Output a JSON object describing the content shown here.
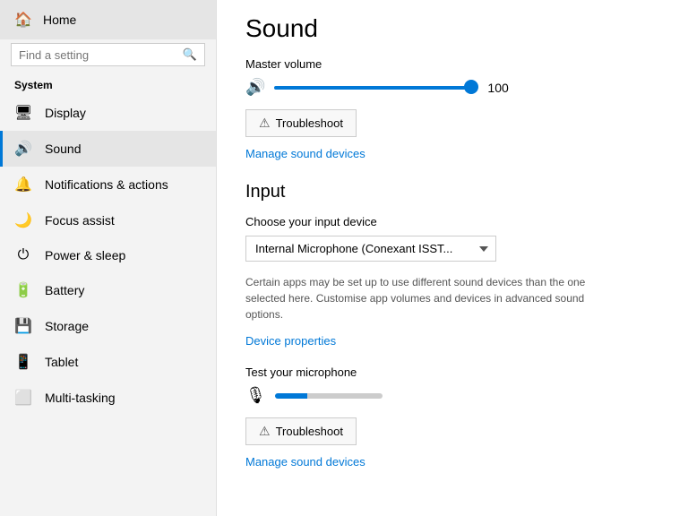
{
  "sidebar": {
    "home_label": "Home",
    "search_placeholder": "Find a setting",
    "system_label": "System",
    "nav_items": [
      {
        "id": "display",
        "label": "Display",
        "icon": "🖥"
      },
      {
        "id": "sound",
        "label": "Sound",
        "icon": "🔊",
        "active": true
      },
      {
        "id": "notifications",
        "label": "Notifications & actions",
        "icon": "🔔"
      },
      {
        "id": "focus",
        "label": "Focus assist",
        "icon": "🌙"
      },
      {
        "id": "power",
        "label": "Power & sleep",
        "icon": "⏻"
      },
      {
        "id": "battery",
        "label": "Battery",
        "icon": "🔋"
      },
      {
        "id": "storage",
        "label": "Storage",
        "icon": "💾"
      },
      {
        "id": "tablet",
        "label": "Tablet",
        "icon": "📱"
      },
      {
        "id": "multitasking",
        "label": "Multi-tasking",
        "icon": "⬜"
      }
    ]
  },
  "main": {
    "page_title": "Sound",
    "master_volume_label": "Master volume",
    "volume_value": "100",
    "troubleshoot_label": "Troubleshoot",
    "manage_devices_label": "Manage sound devices",
    "input_title": "Input",
    "input_device_label": "Choose your input device",
    "input_device_value": "Internal Microphone (Conexant ISST...",
    "hint_text": "Certain apps may be set up to use different sound devices than the one selected here. Customise app volumes and devices in advanced sound options.",
    "device_properties_label": "Device properties",
    "test_mic_label": "Test your microphone",
    "troubleshoot2_label": "Troubleshoot",
    "manage_devices2_label": "Manage sound devices"
  }
}
